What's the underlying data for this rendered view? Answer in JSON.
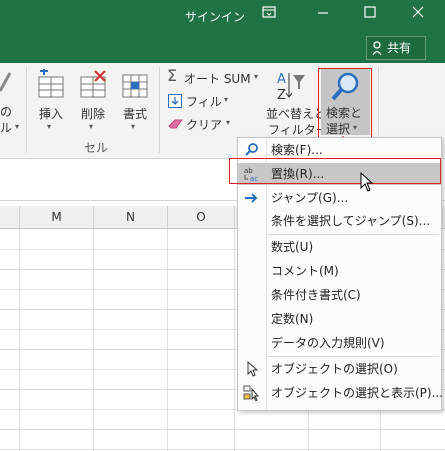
{
  "window": {
    "signin_label": "サインイン",
    "share_label": "共有",
    "accent_color": "#217346"
  },
  "ribbon": {
    "cells_group_label": "セル",
    "insert_label": "挿入",
    "delete_label": "削除",
    "format_label": "書式",
    "partial_label_1": "の",
    "partial_label_2": "ル",
    "autosum_label": "オート SUM",
    "fill_label": "フィル",
    "clear_label": "クリア",
    "sort_filter_label_1": "並べ替えと",
    "sort_filter_label_2": "フィルター",
    "find_select_label_1": "検索と",
    "find_select_label_2": "選択"
  },
  "columns": [
    "M",
    "N",
    "O"
  ],
  "menu": {
    "items": [
      {
        "label": "検索(F)...",
        "icon": "search-icon"
      },
      {
        "label": "置換(R)...",
        "icon": "replace-icon",
        "highlighted": true
      },
      {
        "label": "ジャンプ(G)...",
        "icon": "arrow-right-icon"
      },
      {
        "label": "条件を選択してジャンプ(S)...",
        "icon": ""
      },
      {
        "label": "数式(U)",
        "icon": ""
      },
      {
        "label": "コメント(M)",
        "icon": ""
      },
      {
        "label": "条件付き書式(C)",
        "icon": ""
      },
      {
        "label": "定数(N)",
        "icon": ""
      },
      {
        "label": "データの入力規則(V)",
        "icon": ""
      },
      {
        "label": "オブジェクトの選択(O)",
        "icon": "cursor-icon"
      },
      {
        "label": "オブジェクトの選択と表示(P)...",
        "icon": "selection-pane-icon"
      }
    ]
  }
}
